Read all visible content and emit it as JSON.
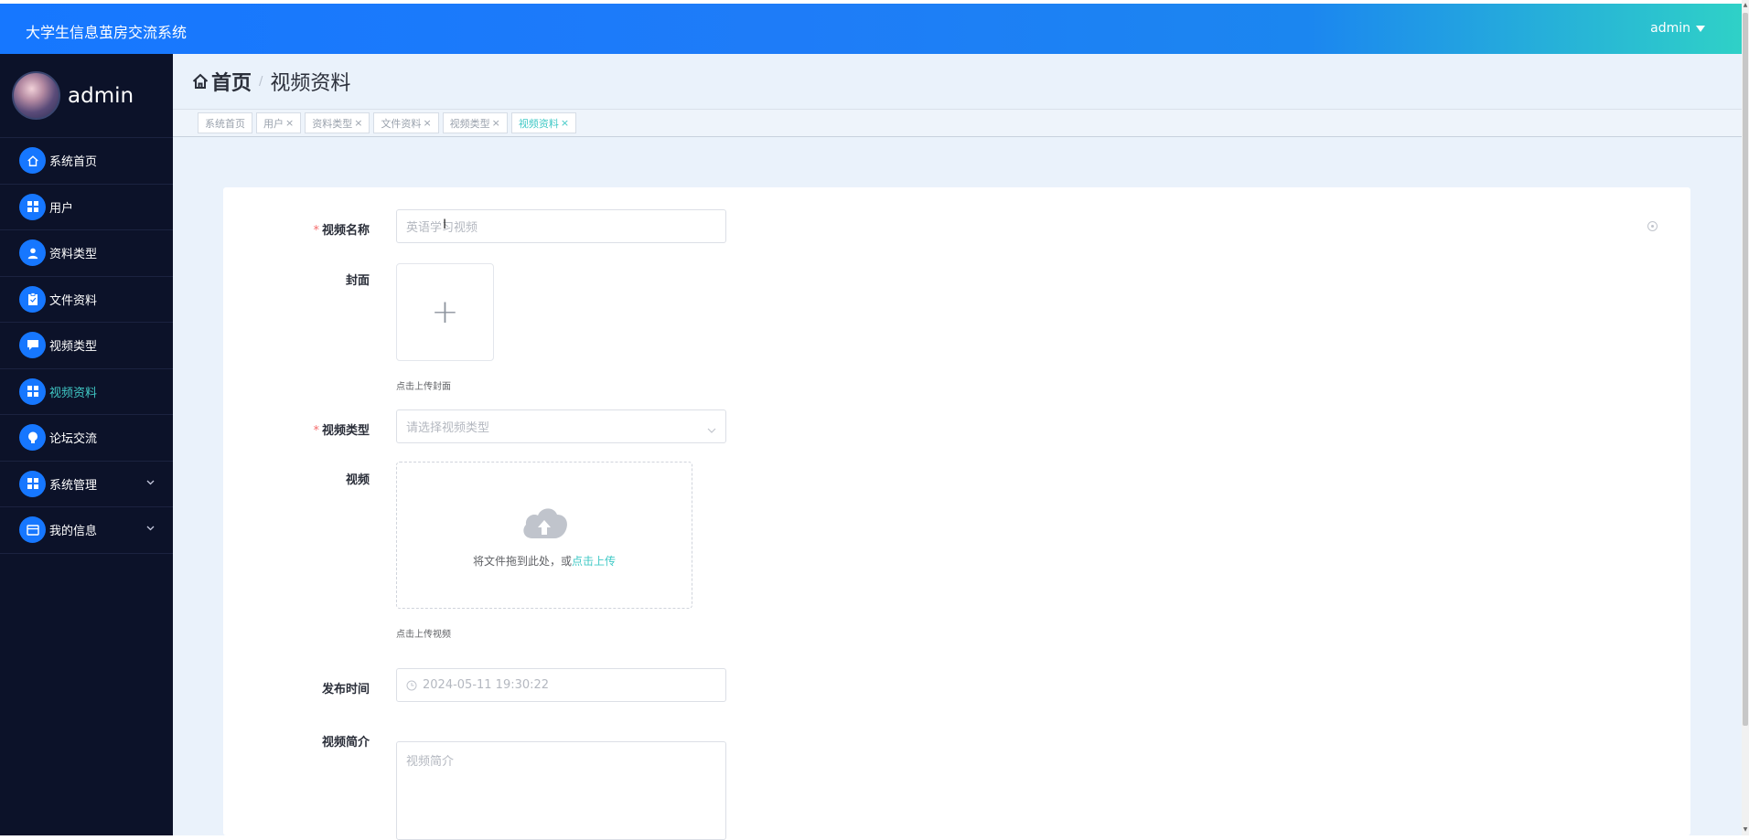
{
  "header": {
    "app_title": "大学生信息茧房交流系统",
    "user_label": "admin"
  },
  "sidebar": {
    "profile_name": "admin",
    "items": [
      {
        "label": "系统首页",
        "icon": "home-icon"
      },
      {
        "label": "用户",
        "icon": "grid-icon"
      },
      {
        "label": "资料类型",
        "icon": "person-icon"
      },
      {
        "label": "文件资料",
        "icon": "clipboard-icon"
      },
      {
        "label": "视频类型",
        "icon": "chat-icon"
      },
      {
        "label": "视频资料",
        "icon": "grid-icon",
        "active": true
      },
      {
        "label": "论坛交流",
        "icon": "bulb-icon"
      },
      {
        "label": "系统管理",
        "icon": "grid-icon",
        "has_children": true
      },
      {
        "label": "我的信息",
        "icon": "card-icon",
        "has_children": true
      }
    ]
  },
  "breadcrumb": {
    "home": "首页",
    "separator": "/",
    "current": "视频资料"
  },
  "tabs": [
    {
      "label": "系统首页",
      "closable": false
    },
    {
      "label": "用户",
      "closable": true
    },
    {
      "label": "资料类型",
      "closable": true
    },
    {
      "label": "文件资料",
      "closable": true
    },
    {
      "label": "视频类型",
      "closable": true
    },
    {
      "label": "视频资料",
      "closable": true,
      "active": true
    }
  ],
  "form": {
    "video_name": {
      "label": "视频名称",
      "required": true,
      "value": "英语学习视频"
    },
    "cover": {
      "label": "封面",
      "hint": "点击上传封面",
      "plus": "+"
    },
    "video_type": {
      "label": "视频类型",
      "required": true,
      "placeholder": "请选择视频类型"
    },
    "video": {
      "label": "视频",
      "drop_text": "将文件拖到此处，或",
      "link_text": "点击上传",
      "hint": "点击上传视频"
    },
    "publish_time": {
      "label": "发布时间",
      "value": "2024-05-11 19:30:22"
    },
    "intro": {
      "label": "视频简介",
      "placeholder": "视频简介"
    }
  },
  "colors": {
    "accent": "#1677ff",
    "active_teal": "#40c9c6",
    "sidebar_bg": "#0c1229",
    "required": "#f56c6c"
  }
}
